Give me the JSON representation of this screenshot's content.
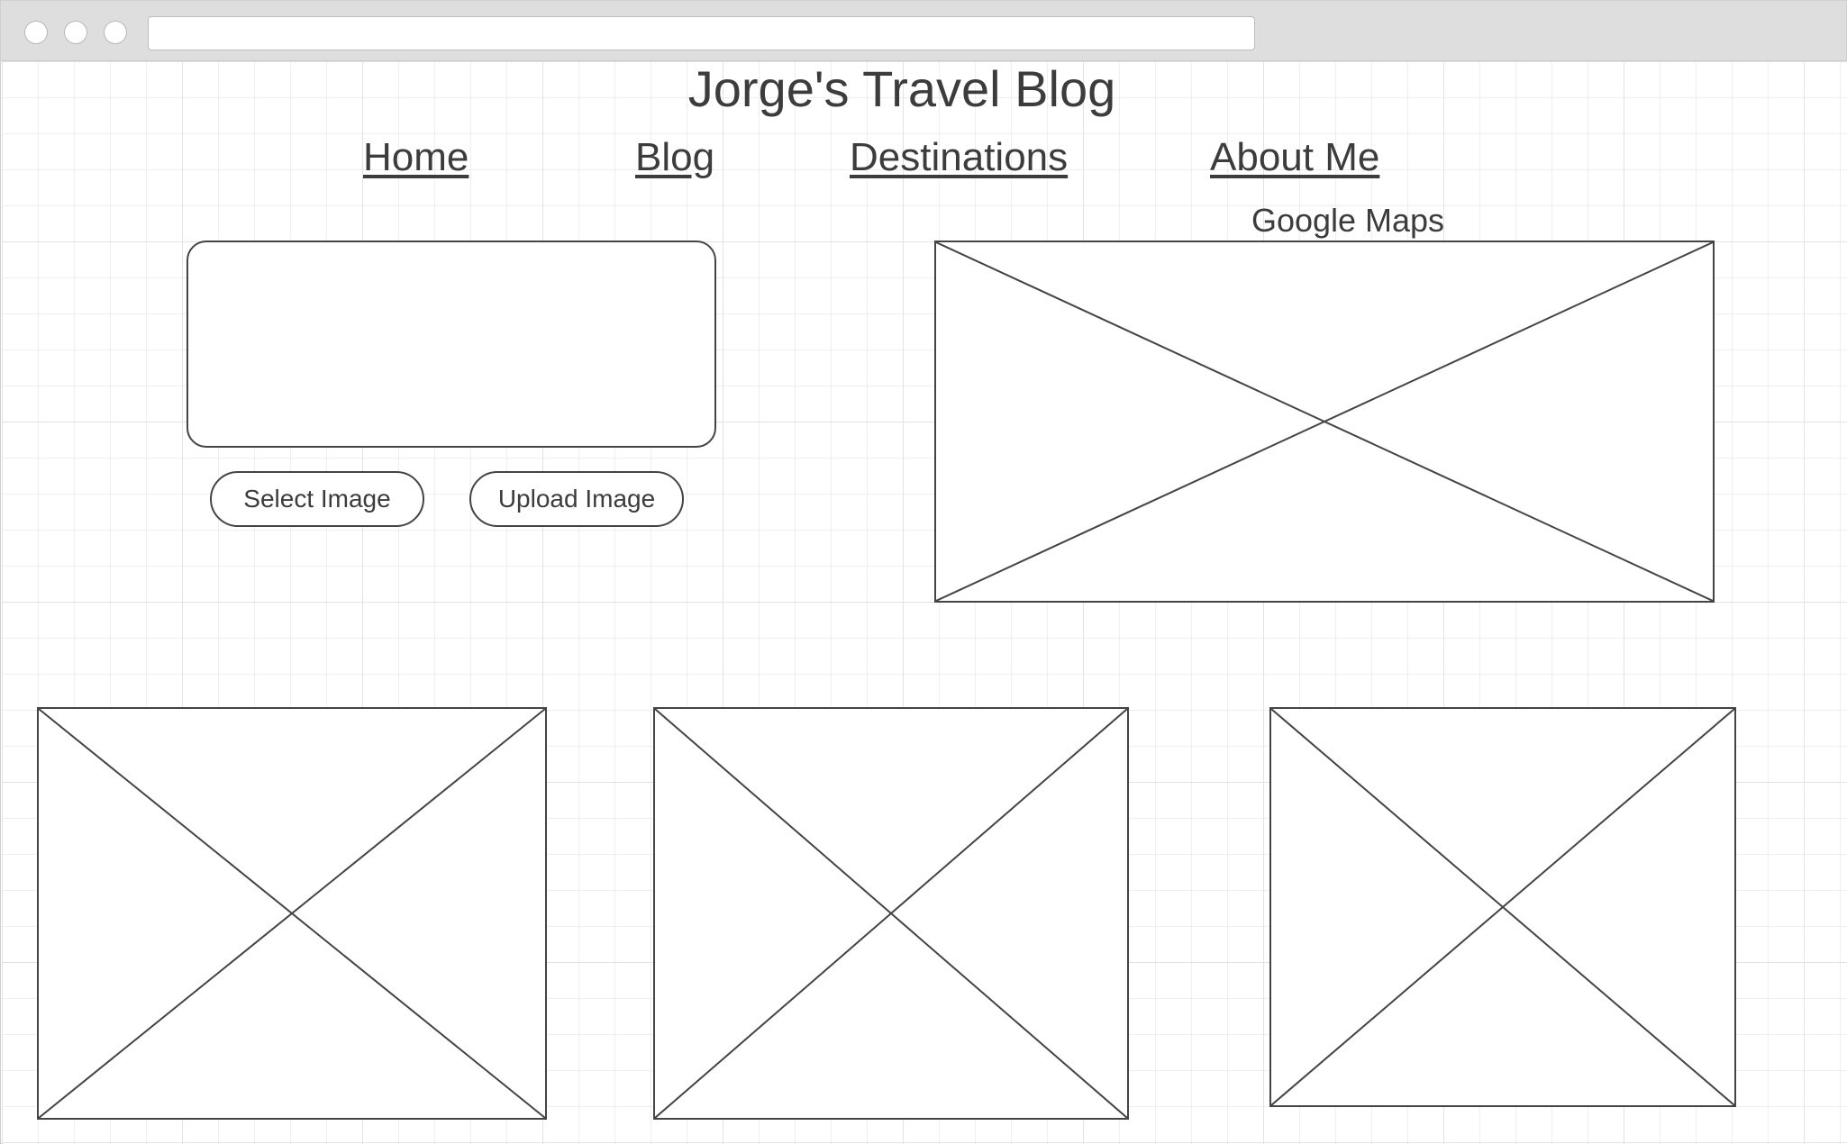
{
  "page": {
    "title": "Jorge's Travel Blog"
  },
  "nav": {
    "items": [
      {
        "label": "Home"
      },
      {
        "label": "Blog"
      },
      {
        "label": "Destinations"
      },
      {
        "label": "About Me"
      }
    ]
  },
  "upload": {
    "select_label": "Select Image",
    "upload_label": "Upload Image"
  },
  "map": {
    "label": "Google Maps"
  },
  "colors": {
    "stroke": "#444444",
    "text": "#3c3c3c",
    "chrome": "#dedede",
    "grid": "#e3e3e3"
  }
}
